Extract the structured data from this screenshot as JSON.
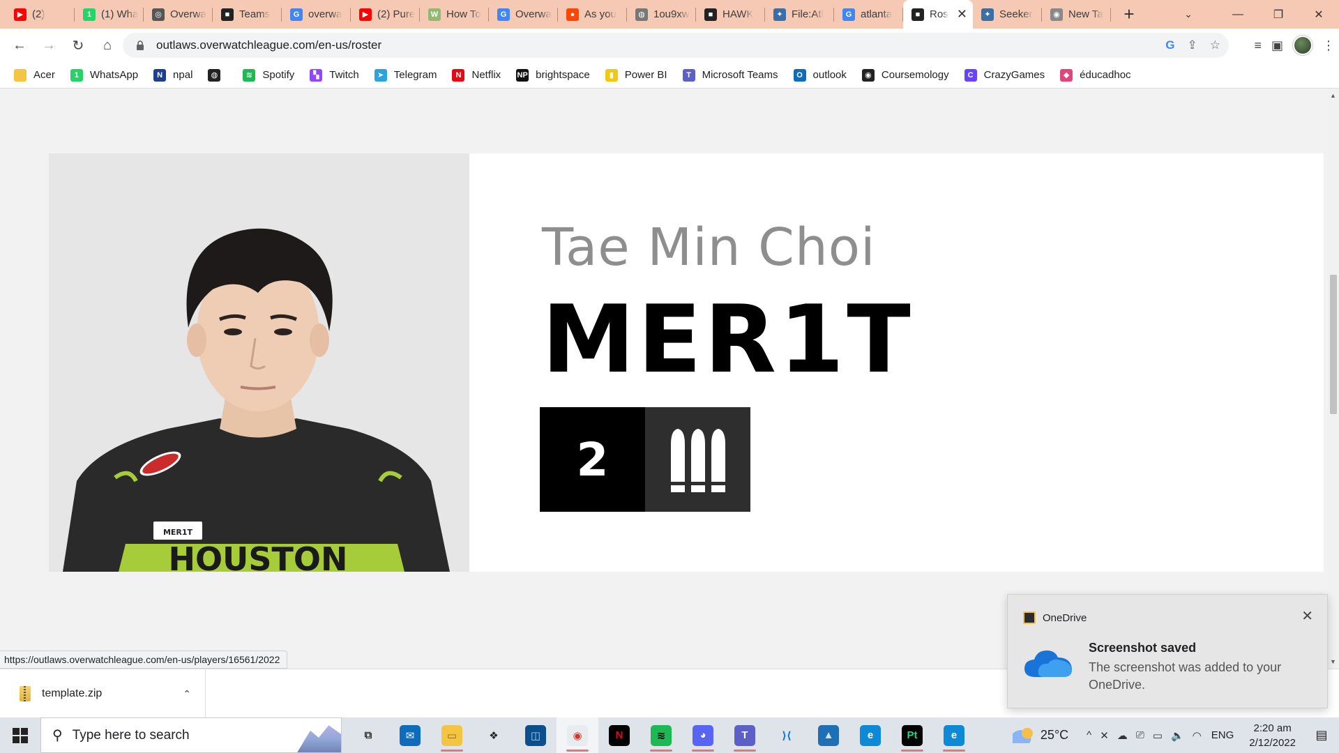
{
  "browser": {
    "tabs": [
      {
        "title": "(2) ",
        "icon": "youtube-icon",
        "color": "#ff0000",
        "glyph": "▶"
      },
      {
        "title": "(1) Wha",
        "icon": "whatsapp-icon",
        "color": "#25d366",
        "glyph": "1"
      },
      {
        "title": "Overwa",
        "icon": "overwatch-icon",
        "color": "#555555",
        "glyph": "◎"
      },
      {
        "title": "Teams",
        "icon": "outlaws-icon",
        "color": "#222222",
        "glyph": "■"
      },
      {
        "title": "overwa",
        "icon": "google-icon",
        "color": "#4285f4",
        "glyph": "G"
      },
      {
        "title": "(2) Pure",
        "icon": "youtube-icon",
        "color": "#ff0000",
        "glyph": "▶"
      },
      {
        "title": "How To",
        "icon": "wikihow-icon",
        "color": "#93b874",
        "glyph": "W"
      },
      {
        "title": "Overwa",
        "icon": "google-icon",
        "color": "#4285f4",
        "glyph": "G"
      },
      {
        "title": "As you",
        "icon": "reddit-icon",
        "color": "#ff4500",
        "glyph": "●"
      },
      {
        "title": "1ou9xw",
        "icon": "globe-icon",
        "color": "#777777",
        "glyph": "◍"
      },
      {
        "title": "HAWK",
        "icon": "outlaws-icon",
        "color": "#222222",
        "glyph": "■"
      },
      {
        "title": "File:Atl",
        "icon": "wiki-icon",
        "color": "#3a6ea5",
        "glyph": "✦"
      },
      {
        "title": "atlanta",
        "icon": "google-icon",
        "color": "#4285f4",
        "glyph": "G"
      },
      {
        "title": "Ros",
        "icon": "outlaws-icon",
        "color": "#222222",
        "glyph": "■",
        "active": true
      },
      {
        "title": "Seeker",
        "icon": "wiki-icon",
        "color": "#3a6ea5",
        "glyph": "✦"
      },
      {
        "title": "New Ta",
        "icon": "chrome-icon",
        "color": "#888888",
        "glyph": "◉"
      }
    ],
    "tab_close": "✕",
    "new_tab": "+",
    "tab_search": "⌄",
    "window": {
      "minimize": "—",
      "restore": "❐",
      "close": "✕"
    },
    "nav": {
      "back": "←",
      "forward": "→",
      "reload": "↻",
      "home": "⌂"
    },
    "url": "outlaws.overwatchleague.com/en-us/roster",
    "omni_icons": {
      "google": "G",
      "share": "⇪",
      "star": "☆"
    },
    "toolbar_icons": {
      "media": "≡",
      "sidepanel": "▣",
      "menu": "⋮"
    },
    "bookmarks": [
      {
        "label": "Acer",
        "icon": "folder-icon",
        "color": "#f4c542",
        "glyph": ""
      },
      {
        "label": "WhatsApp",
        "icon": "whatsapp-icon",
        "color": "#25d366",
        "glyph": "1"
      },
      {
        "label": "npal",
        "icon": "npal-icon",
        "color": "#1c3f94",
        "glyph": "N"
      },
      {
        "label": "",
        "icon": "globe-icon",
        "color": "#222222",
        "glyph": "◍"
      },
      {
        "label": "Spotify",
        "icon": "spotify-icon",
        "color": "#1db954",
        "glyph": "≋"
      },
      {
        "label": "Twitch",
        "icon": "twitch-icon",
        "color": "#9146ff",
        "glyph": "▚"
      },
      {
        "label": "Telegram",
        "icon": "telegram-icon",
        "color": "#2aa3df",
        "glyph": "➤"
      },
      {
        "label": "Netflix",
        "icon": "netflix-icon",
        "color": "#e50914",
        "glyph": "N"
      },
      {
        "label": "brightspace",
        "icon": "brightspace-icon",
        "color": "#111111",
        "glyph": "NP"
      },
      {
        "label": "Power BI",
        "icon": "powerbi-icon",
        "color": "#f2c811",
        "glyph": "▮"
      },
      {
        "label": "Microsoft Teams",
        "icon": "teams-icon",
        "color": "#5b5fc7",
        "glyph": "T"
      },
      {
        "label": "outlook",
        "icon": "outlook-icon",
        "color": "#0f6cbd",
        "glyph": "O"
      },
      {
        "label": "Coursemology",
        "icon": "coursemology-icon",
        "color": "#222222",
        "glyph": "◉"
      },
      {
        "label": "CrazyGames",
        "icon": "crazygames-icon",
        "color": "#6842ff",
        "glyph": "C"
      },
      {
        "label": "éducadhoc",
        "icon": "educadhoc-icon",
        "color": "#e0457b",
        "glyph": "◆"
      }
    ]
  },
  "player": {
    "real_name": "Tae Min Choi",
    "gamertag": "MER1T",
    "jersey_number": "2",
    "role_icon": "damage-role-icon"
  },
  "status_url": "https://outlaws.overwatchleague.com/en-us/players/16561/2022",
  "download": {
    "filename": "template.zip",
    "chevron": "⌃"
  },
  "toast": {
    "app": "OneDrive",
    "title": "Screenshot saved",
    "body": "The screenshot was added to your OneDrive.",
    "close": "✕"
  },
  "taskbar": {
    "search_placeholder": "Type here to search",
    "apps": [
      {
        "name": "task-view-icon",
        "color": "transparent",
        "glyph": "⧉",
        "fg": "#333"
      },
      {
        "name": "mail-icon",
        "color": "#0f6cbd",
        "glyph": "✉",
        "fg": "#fff"
      },
      {
        "name": "file-explorer-icon",
        "color": "#f4c542",
        "glyph": "▭",
        "fg": "#8a6a10",
        "open": true
      },
      {
        "name": "dropbox-icon",
        "color": "transparent",
        "glyph": "❖",
        "fg": "#222"
      },
      {
        "name": "app-blue-icon",
        "color": "#0b4f8a",
        "glyph": "◫",
        "fg": "#9fd3ff"
      },
      {
        "name": "chrome-icon",
        "color": "#e9ecef",
        "glyph": "◉",
        "fg": "#d93025",
        "open": true,
        "active": true
      },
      {
        "name": "netflix-icon",
        "color": "#000000",
        "glyph": "N",
        "fg": "#e50914"
      },
      {
        "name": "spotify-icon",
        "color": "#1db954",
        "glyph": "≋",
        "fg": "#000",
        "open": true
      },
      {
        "name": "discord-icon",
        "color": "#5865f2",
        "glyph": "◕",
        "fg": "#fff",
        "open": true
      },
      {
        "name": "teams-icon",
        "color": "#5b5fc7",
        "glyph": "T",
        "fg": "#fff",
        "open": true
      },
      {
        "name": "vscode-icon",
        "color": "transparent",
        "glyph": "⟩⟨",
        "fg": "#0078d4"
      },
      {
        "name": "photos-icon",
        "color": "#1f6fb5",
        "glyph": "▲",
        "fg": "#cfe6ff"
      },
      {
        "name": "edge-icon",
        "color": "#0c8ad8",
        "glyph": "e",
        "fg": "#fff"
      },
      {
        "name": "pycharm-icon",
        "color": "#000000",
        "glyph": "Pt",
        "fg": "#21d789",
        "open": true
      },
      {
        "name": "edge-dev-icon",
        "color": "#0c8ad8",
        "glyph": "e",
        "fg": "#fff",
        "open": true
      }
    ],
    "weather": "25°C",
    "tray_icons": [
      "^",
      "✕",
      "☁",
      "⎚",
      "▭",
      "🔈",
      "◠"
    ],
    "language": "ENG",
    "time": "2:20 am",
    "date": "2/12/2022",
    "notification_glyph": "▤"
  }
}
